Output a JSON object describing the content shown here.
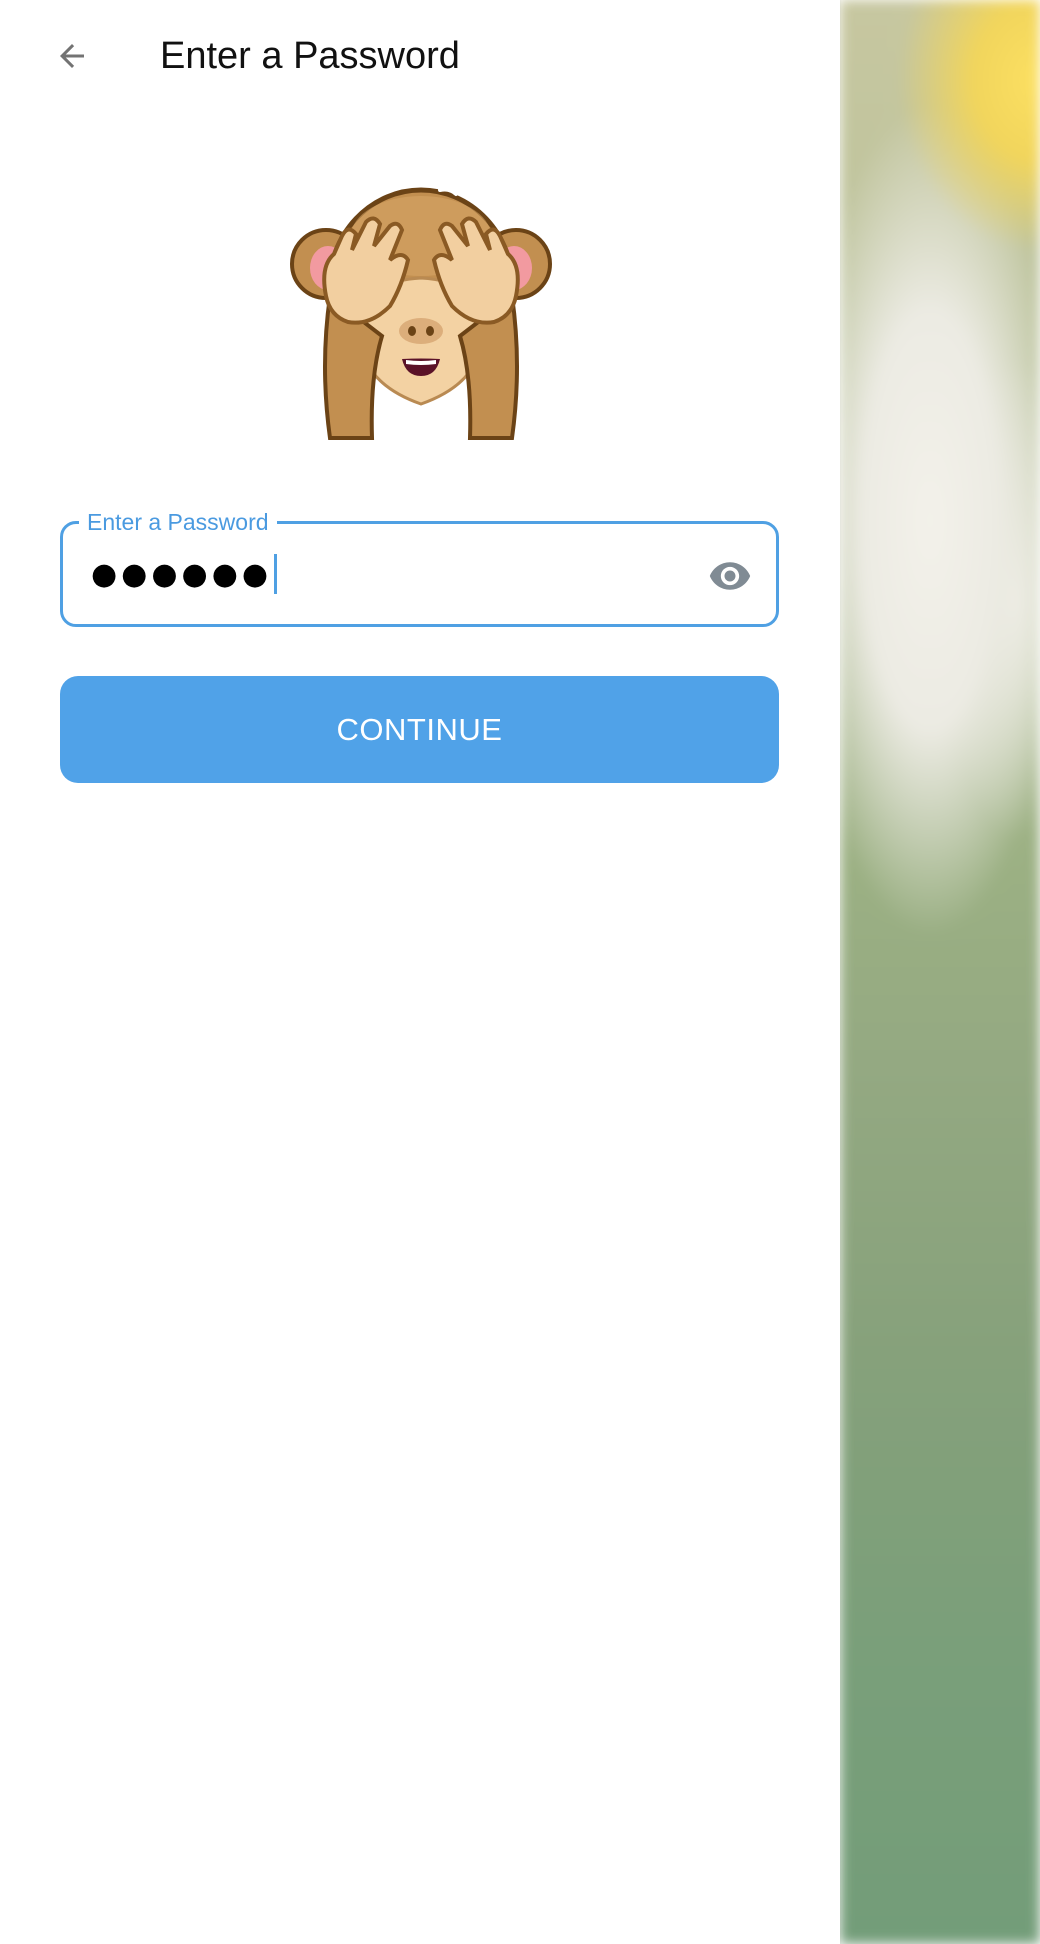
{
  "header": {
    "title": "Enter a Password"
  },
  "password_field": {
    "label": "Enter a Password",
    "value": "●●●●●●",
    "visibility_icon": "eye-icon"
  },
  "continue_button": {
    "label": "CONTINUE"
  },
  "illustration": "see-no-evil-monkey",
  "colors": {
    "accent": "#50a2e8",
    "field_border": "#4fa0e3",
    "title_text": "#111111",
    "icon_gray": "#808b94"
  }
}
